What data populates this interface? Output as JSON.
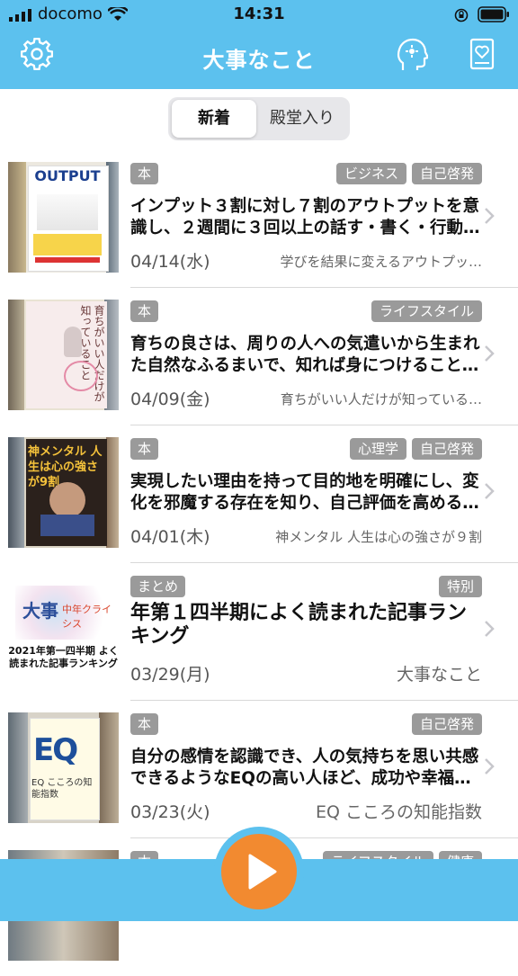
{
  "status": {
    "carrier": "docomo",
    "time": "14:31"
  },
  "nav": {
    "title": "大事なこと",
    "icons": [
      "gear-icon",
      "mind-icon",
      "book-heart-icon"
    ]
  },
  "segment": {
    "tabs": [
      "新着",
      "殿堂入り"
    ],
    "selected": "新着"
  },
  "colors": {
    "header": "#5cc1ee",
    "play": "#f28a30",
    "badge": "#9a9a9a"
  },
  "items": [
    {
      "type": "本",
      "tags": [
        "ビジネス",
        "自己啓発"
      ],
      "title": "インプット３割に対し７割のアウトプットを意識し、２週間に３回以上の話す・書く・行動…",
      "date": "04/14(水)",
      "source": "学びを結果に変えるアウトプッ…",
      "cover": "OUTPUT"
    },
    {
      "type": "本",
      "tags": [
        "ライフスタイル"
      ],
      "title": "育ちの良さは、周りの人への気遣いから生まれた自然なふるまいで、知れば身につけること…",
      "date": "04/09(金)",
      "source": "育ちがいい人だけが知っている…",
      "cover": "育ちがいい人だけが知っていること"
    },
    {
      "type": "本",
      "tags": [
        "心理学",
        "自己啓発"
      ],
      "title": "実現したい理由を持って目的地を明確にし、変化を邪魔する存在を知り、自己評価を高める…",
      "date": "04/01(木)",
      "source": "神メンタル 人生は心の強さが９割",
      "cover": "神メンタル 人生は心の強さが9割"
    },
    {
      "type": "まとめ",
      "tags": [
        "特別"
      ],
      "title": "年第１四半期によく読まれた記事ランキング",
      "date": "03/29(月)",
      "source": "大事なこと",
      "cover": "2021年第一四半期 よく読まれた記事ランキング"
    },
    {
      "type": "本",
      "tags": [
        "自己啓発"
      ],
      "title": "自分の感情を認識でき、人の気持ちを思い共感できるようなEQの高い人ほど、成功や幸福…",
      "date": "03/23(火)",
      "source": "EQ こころの知能指数",
      "cover": "EQ こころの知能指数"
    },
    {
      "type": "本",
      "tags": [
        "ライフスタイル",
        "健康"
      ],
      "title": "",
      "date": "",
      "source": "",
      "cover": ""
    }
  ]
}
